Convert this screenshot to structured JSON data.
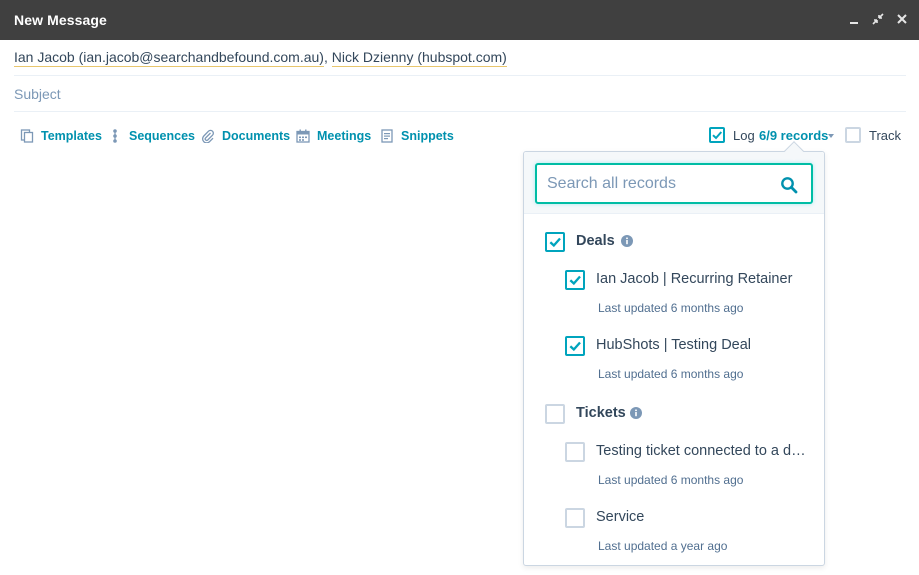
{
  "window": {
    "title": "New Message"
  },
  "compose": {
    "recipients": [
      "Ian Jacob (ian.jacob@searchandbefound.com.au)",
      "Nick Dzienny (hubspot.com)"
    ],
    "subject_placeholder": "Subject"
  },
  "toolbar": {
    "templates": "Templates",
    "sequences": "Sequences",
    "documents": "Documents",
    "meetings": "Meetings",
    "snippets": "Snippets",
    "log_label": "Log",
    "log_records": "6/9 records",
    "log_checked": true,
    "track_label": "Track",
    "track_checked": false
  },
  "popover": {
    "search_placeholder": "Search all records",
    "groups": [
      {
        "label": "Deals",
        "checked": true,
        "items": [
          {
            "label": "Ian Jacob | Recurring Retainer",
            "meta": "Last updated 6 months ago",
            "checked": true
          },
          {
            "label": "HubShots | Testing Deal",
            "meta": "Last updated 6 months ago",
            "checked": true
          }
        ]
      },
      {
        "label": "Tickets",
        "checked": false,
        "items": [
          {
            "label": "Testing ticket connected to a deal",
            "meta": "Last updated 6 months ago",
            "checked": false
          },
          {
            "label": "Service",
            "meta": "Last updated a year ago",
            "checked": false
          }
        ]
      }
    ]
  },
  "colors": {
    "accent": "#0091ae",
    "check": "#00a4bd",
    "titlebar": "#404040",
    "focus": "#00bda5"
  }
}
